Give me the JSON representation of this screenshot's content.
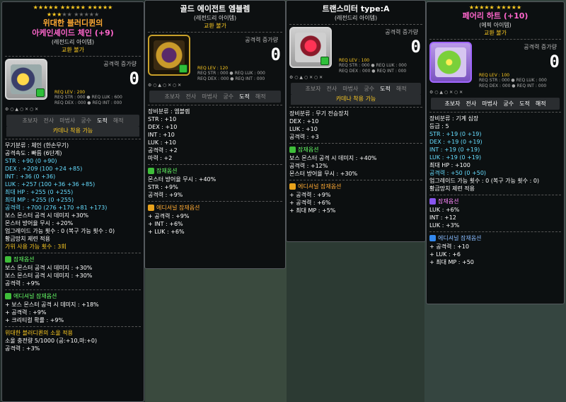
{
  "tooltip1": {
    "stars_on": 15,
    "stars_off": 7,
    "title": "위대한 블러디퀸의",
    "title2": "아케인셰이드 체인 (+9)",
    "grade": "(레전드리 아이템)",
    "trade": "교환 불가",
    "atk_label": "공격력 증가량",
    "atk_value": "0",
    "req_lev": "REQ LEV : 200",
    "req1": "REQ STR : 000   ● REQ LUK : 600",
    "req2": "REQ DEX : 000   ● REQ INT : 000",
    "jobs": [
      "초보자",
      "전사",
      "마법사",
      "궁수",
      "도적",
      "해적"
    ],
    "job_active": 4,
    "cadena": "카데나 착용 가능",
    "stats": [
      {
        "text": "무기분류 : 체인 (한손무기)",
        "color": "white"
      },
      {
        "text": "공격속도 : 빠름 (6단계)",
        "color": "white"
      },
      {
        "text": "STR : +90 (0 +90)",
        "color": "cyan"
      },
      {
        "text": "DEX : +209 (100 +24 +85)",
        "color": "cyan"
      },
      {
        "text": "INT : +36 (0 +36)",
        "color": "cyan"
      },
      {
        "text": "LUK : +257 (100 +36 +36 +85)",
        "color": "cyan"
      },
      {
        "text": "최대 HP : +255 (0 +255)",
        "color": "cyan"
      },
      {
        "text": "최대 MP : +255 (0 +255)",
        "color": "cyan"
      },
      {
        "text": "공격력 : +700 (276 +170 +81 +173)",
        "color": "cyan"
      },
      {
        "text": "보스 몬스터 공격 시 데미지 +30%",
        "color": "white"
      },
      {
        "text": "몬스터 방어율 무시 : +20%",
        "color": "white"
      },
      {
        "text": "업그레이드 가능 횟수 : 0 (복구 가능 횟수 : 0)",
        "color": "white"
      },
      {
        "text": "황금망치 제련 적용",
        "color": "white"
      },
      {
        "text": "가위 사용 가능 횟수 : 3회",
        "color": "yellow"
      }
    ],
    "pot_head": "잠재옵션",
    "pot": [
      "보스 몬스터 공격 시 데미지 : +30%",
      "보스 몬스터 공격 시 데미지 : +30%",
      "공격력 : +9%"
    ],
    "add_head": "에디셔널 잠재옵션",
    "add": [
      "+ 보스 몬스터 공격 시 데미지 : +18%",
      "+ 공격력 : +9%",
      "+ 크리티컬 확률 : +9%"
    ],
    "set_name": "위대한 블러디퀸의 소울 적용",
    "soul1": "소울 충전량 5/1000 (공:+10,마:+0)",
    "soul2": "공격력 : +3%"
  },
  "tooltip2": {
    "title": "골드 에이전트 엠블렘",
    "grade": "(레전드리 아이템)",
    "trade": "교환 불가",
    "atk_label": "공격력 증가량",
    "atk_value": "0",
    "req_lev": "REQ LEV : 120",
    "req1": "REQ STR : 000   ● REQ LUK : 000",
    "req2": "REQ DEX : 000   ● REQ INT : 000",
    "jobs": [
      "초보자",
      "전사",
      "마법사",
      "궁수",
      "도적",
      "해적"
    ],
    "job_active": 4,
    "stats": [
      {
        "text": "장비분류 : 엠블렘",
        "color": "white"
      },
      {
        "text": "STR : +10",
        "color": "white"
      },
      {
        "text": "DEX : +10",
        "color": "white"
      },
      {
        "text": "INT : +10",
        "color": "white"
      },
      {
        "text": "LUK : +10",
        "color": "white"
      },
      {
        "text": "공격력 : +2",
        "color": "white"
      },
      {
        "text": "마력 : +2",
        "color": "white"
      }
    ],
    "pot_head": "잠재옵션",
    "pot": [
      "몬스터 방어율 무시 : +40%",
      "STR : +9%",
      "공격력 : +9%"
    ],
    "add_head": "에디셔널 잠재옵션",
    "add": [
      "+ 공격력 : +9%",
      "+ INT : +6%",
      "+ LUK : +6%"
    ]
  },
  "tooltip3": {
    "title": "트랜스미터 type:A",
    "grade": "(레전드리 아이템)",
    "atk_label": "공격력 증가량",
    "atk_value": "0",
    "req_lev": "REQ LEV : 100",
    "req1": "REQ STR : 000   ● REQ LUK : 000",
    "req2": "REQ DEX : 000   ● REQ INT : 000",
    "jobs": [
      "초보자",
      "전사",
      "마법사",
      "궁수",
      "도적",
      "해적"
    ],
    "job_active": 4,
    "cadena": "카데나 착용 가능",
    "stats": [
      {
        "text": "장비분류 : 무기 전승장치",
        "color": "white"
      },
      {
        "text": "DEX : +10",
        "color": "white"
      },
      {
        "text": "LUK : +10",
        "color": "white"
      },
      {
        "text": "공격력 : +3",
        "color": "white"
      }
    ],
    "pot_head": "잠재옵션",
    "pot": [
      "보스 몬스터 공격 시 데미지 : +40%",
      "공격력 : +12%",
      "몬스터 방어율 무시 : +30%"
    ],
    "add_head": "에디셔널 잠재옵션",
    "add": [
      "+ 공격력 : +9%",
      "+ 공격력 : +6%",
      "+ 최대 MP : +5%"
    ]
  },
  "tooltip4": {
    "stars_on": 10,
    "title": "페어리 하트 (+10)",
    "grade": "(에픽 아이템)",
    "trade": "교환 불가",
    "atk_label": "공격력 증가량",
    "atk_value": "0",
    "req_lev": "REQ LEV : 100",
    "req1": "REQ STR : 000   ● REQ LUK : 000",
    "req2": "REQ DEX : 000   ● REQ INT : 000",
    "jobs": [
      "초보자",
      "전사",
      "마법사",
      "궁수",
      "도적",
      "해적"
    ],
    "stats": [
      {
        "text": "장비분류 : 기계 심장",
        "color": "white"
      },
      {
        "text": "등급 : 5",
        "color": "white"
      },
      {
        "text": "STR : +19 (0 +19)",
        "color": "cyan"
      },
      {
        "text": "DEX : +19 (0 +19)",
        "color": "cyan"
      },
      {
        "text": "INT : +19 (0 +19)",
        "color": "cyan"
      },
      {
        "text": "LUK : +19 (0 +19)",
        "color": "cyan"
      },
      {
        "text": "최대 HP : +100",
        "color": "white"
      },
      {
        "text": "공격력 : +50 (0 +50)",
        "color": "cyan"
      },
      {
        "text": "업그레이드 가능 횟수 : 0 (복구 가능 횟수 : 0)",
        "color": "white"
      },
      {
        "text": "황금망치 제련 적용",
        "color": "white"
      }
    ],
    "pot_head": "잠재옵션",
    "pot": [
      "LUK : +6%",
      "INT : +12",
      "LUK : +3%"
    ],
    "add_head": "에디셔널 잠재옵션",
    "add": [
      "+ 공격력 : +10",
      "+ LUK : +6",
      "+ 최대 MP : +50"
    ]
  }
}
